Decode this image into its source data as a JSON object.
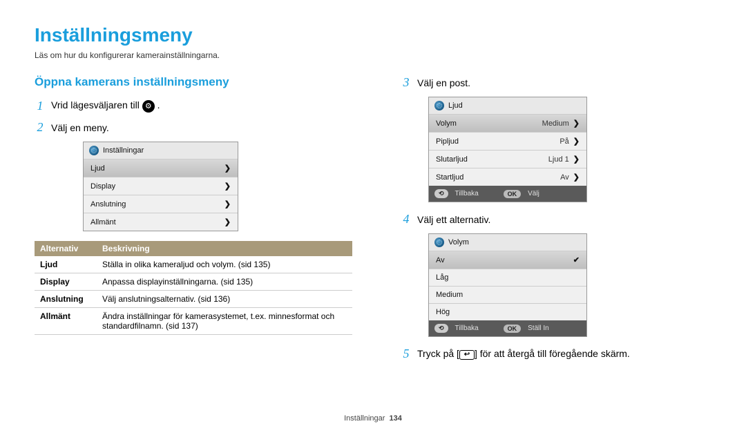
{
  "title": "Inställningsmeny",
  "intro": "Läs om hur du konfigurerar kamerainställningarna.",
  "section_title": "Öppna kamerans inställningsmeny",
  "steps": {
    "s1": {
      "num": "1",
      "text_before": "Vrid lägesväljaren till ",
      "text_after": " ."
    },
    "s2": {
      "num": "2",
      "text": "Välj en meny."
    },
    "s3": {
      "num": "3",
      "text": "Välj en post."
    },
    "s4": {
      "num": "4",
      "text": "Välj ett alternativ."
    },
    "s5": {
      "num": "5",
      "text_before": "Tryck på [",
      "text_after": "] för att återgå till föregående skärm."
    }
  },
  "screen1": {
    "header": "Inställningar",
    "items": [
      "Ljud",
      "Display",
      "Anslutning",
      "Allmänt"
    ]
  },
  "screen2": {
    "header": "Ljud",
    "rows": [
      {
        "label": "Volym",
        "value": "Medium"
      },
      {
        "label": "Pipljud",
        "value": "På"
      },
      {
        "label": "Slutarljud",
        "value": "Ljud 1"
      },
      {
        "label": "Startljud",
        "value": "Av"
      }
    ],
    "footer_back": "Tillbaka",
    "footer_ok_btn": "OK",
    "footer_ok": "Välj"
  },
  "screen3": {
    "header": "Volym",
    "rows": [
      "Av",
      "Låg",
      "Medium",
      "Hög"
    ],
    "footer_back": "Tillbaka",
    "footer_ok_btn": "OK",
    "footer_ok": "Ställ In"
  },
  "desc_table": {
    "headers": {
      "opt": "Alternativ",
      "desc": "Beskrivning"
    },
    "rows": [
      {
        "opt": "Ljud",
        "desc": "Ställa in olika kameraljud och volym. (sid 135)"
      },
      {
        "opt": "Display",
        "desc": "Anpassa displayinställningarna. (sid 135)"
      },
      {
        "opt": "Anslutning",
        "desc": "Välj anslutningsalternativ. (sid 136)"
      },
      {
        "opt": "Allmänt",
        "desc": "Ändra inställningar för kamerasystemet, t.ex. minnesformat och standardfilnamn. (sid 137)"
      }
    ]
  },
  "footer": {
    "label": "Inställningar",
    "page": "134"
  },
  "glyphs": {
    "gear": "⚙",
    "back_arrow": "↩"
  }
}
